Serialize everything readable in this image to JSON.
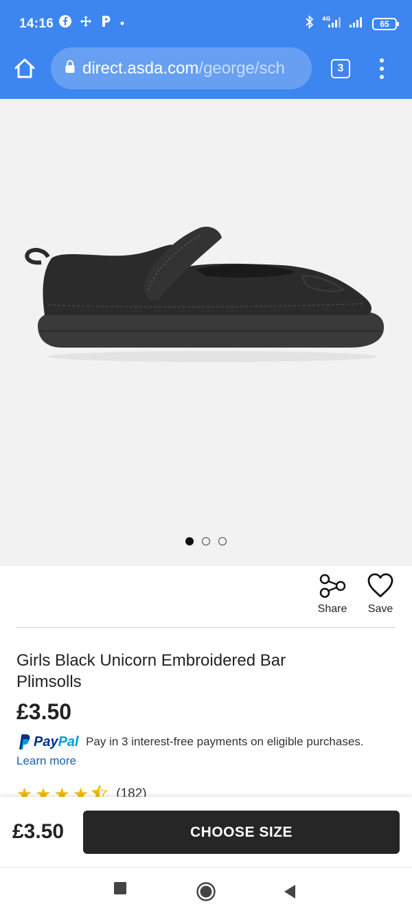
{
  "status_bar": {
    "time": "14:16",
    "left_icons": [
      "facebook-icon",
      "move-icon",
      "parking-icon",
      "dot-icon"
    ],
    "right_icons": [
      "bluetooth-icon",
      "signal-4g-icon",
      "signal-icon"
    ],
    "network": "4G",
    "battery": "65"
  },
  "browser": {
    "url_host": "direct.asda.com",
    "url_path": "/george/sch",
    "tab_count": "3"
  },
  "product": {
    "carousel": {
      "count": 3,
      "active_index": 0
    },
    "share_label": "Share",
    "save_label": "Save",
    "title": "Girls Black Unicorn Embroidered Bar Plimsolls",
    "price": "£3.50",
    "paypal": {
      "pay": "Pay",
      "pal": "Pal",
      "text": "Pay in 3 interest-free payments on eligible purchases.",
      "learn_more": "Learn more"
    },
    "rating": {
      "stars": 4.5,
      "max": 5,
      "count": "(182)"
    }
  },
  "bottom_bar": {
    "price": "£3.50",
    "cta_label": "CHOOSE SIZE"
  },
  "colors": {
    "browser_bar": "#3d86f0",
    "star": "#f2b705",
    "cta_bg": "#262626",
    "link": "#1b5fad"
  }
}
